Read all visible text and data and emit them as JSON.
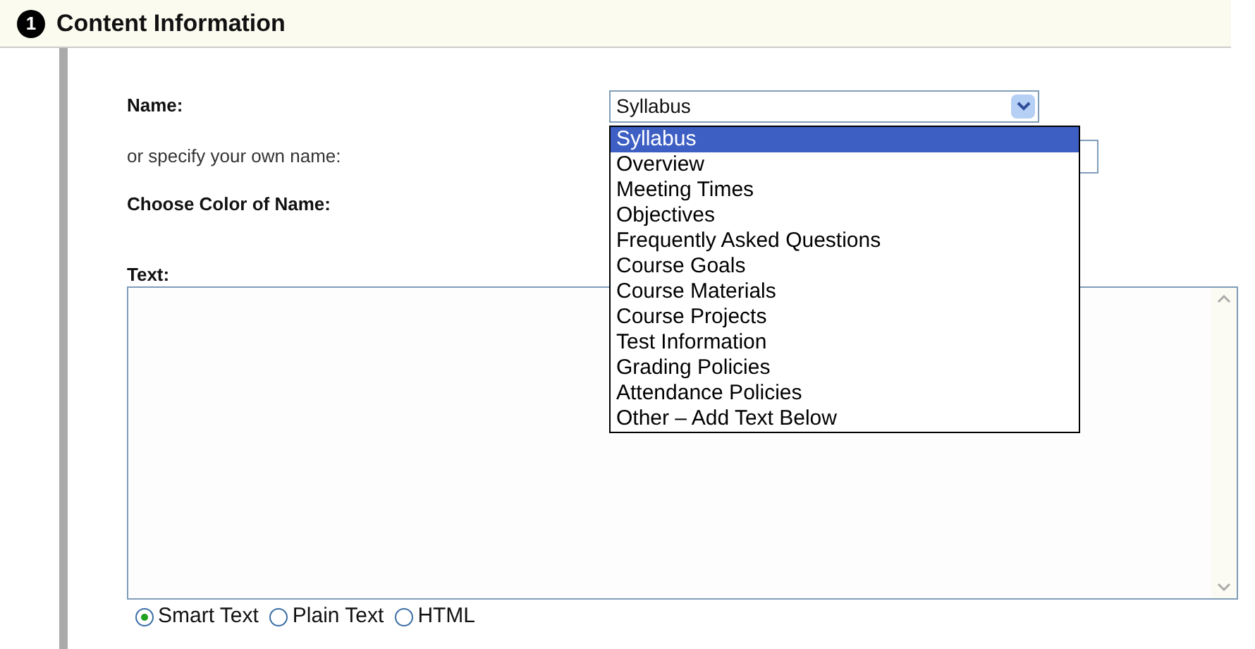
{
  "section": {
    "number": "1",
    "title": "Content Information"
  },
  "fields": {
    "name_label": "Name:",
    "own_name_label": "or specify your own name:",
    "color_label": "Choose Color of Name:",
    "text_label": "Text:"
  },
  "name_select": {
    "value": "Syllabus",
    "expanded": true,
    "options": [
      {
        "label": "Syllabus",
        "selected": true
      },
      {
        "label": "Overview",
        "selected": false
      },
      {
        "label": "Meeting Times",
        "selected": false
      },
      {
        "label": "Objectives",
        "selected": false
      },
      {
        "label": "Frequently Asked Questions",
        "selected": false
      },
      {
        "label": "Course Goals",
        "selected": false
      },
      {
        "label": "Course Materials",
        "selected": false
      },
      {
        "label": "Course Projects",
        "selected": false
      },
      {
        "label": "Test Information",
        "selected": false
      },
      {
        "label": "Grading Policies",
        "selected": false
      },
      {
        "label": "Attendance Policies",
        "selected": false
      },
      {
        "label": "Other – Add Text Below",
        "selected": false
      }
    ]
  },
  "text_format": [
    {
      "label": "Smart Text",
      "selected": true
    },
    {
      "label": "Plain Text",
      "selected": false
    },
    {
      "label": "HTML",
      "selected": false
    }
  ]
}
